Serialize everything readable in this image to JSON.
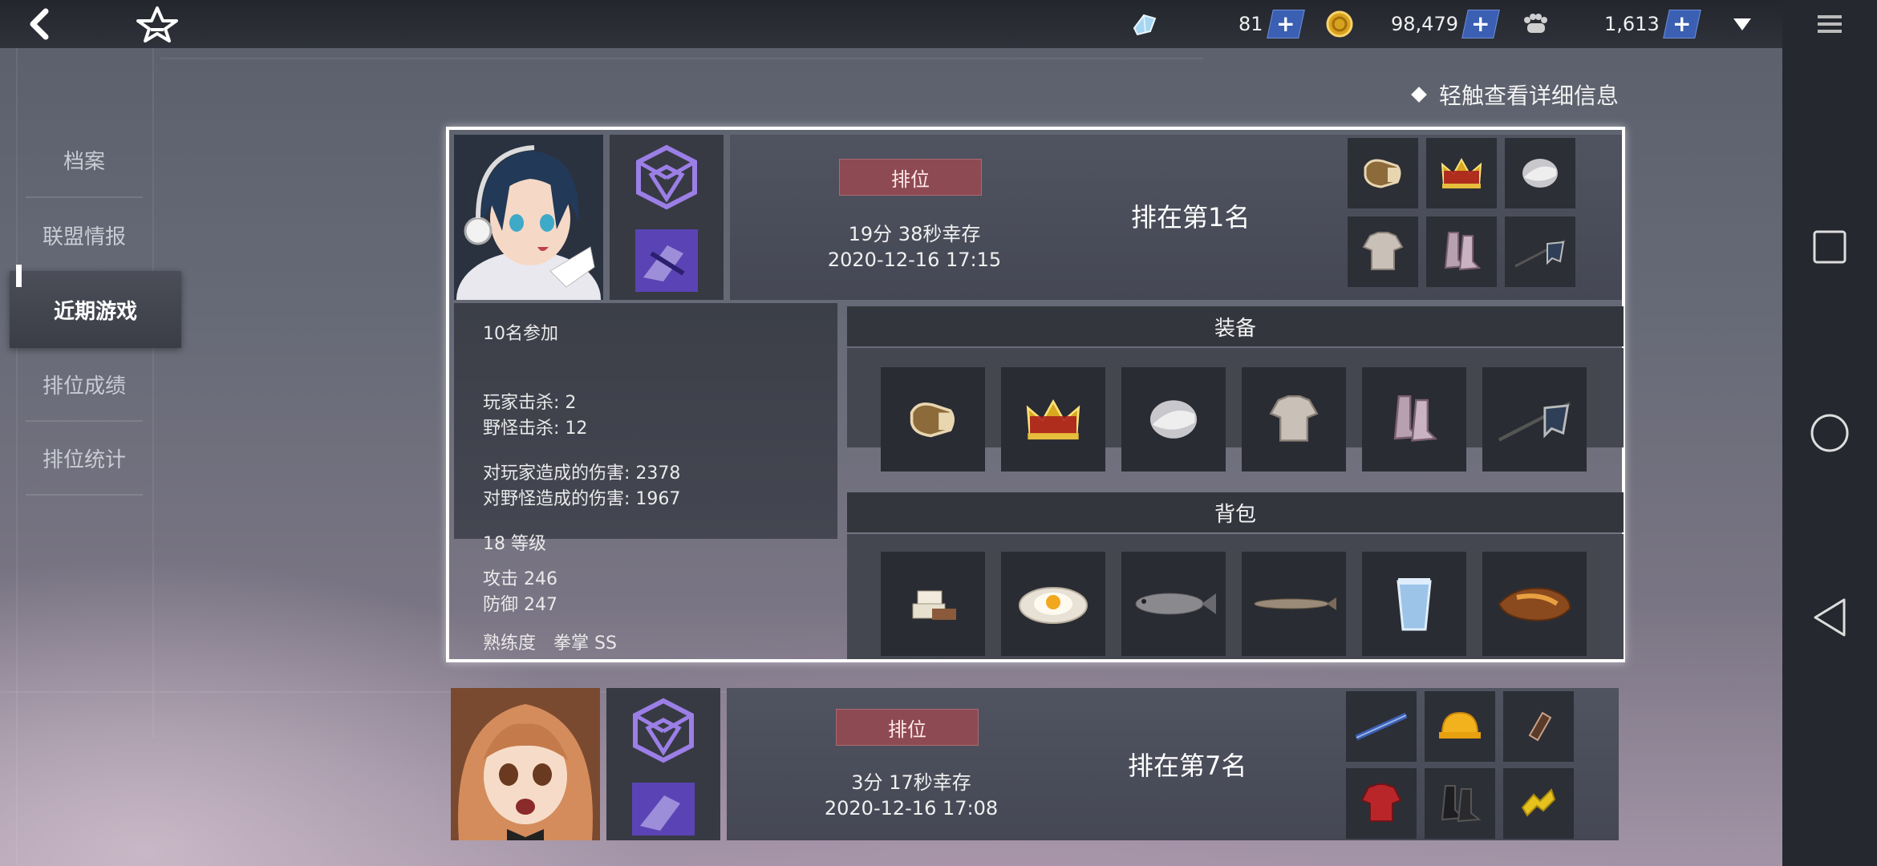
{
  "topbar": {
    "back_icon": "back-arrow-icon",
    "logo_icon": "star-a-logo-icon",
    "resources": [
      {
        "icon": "crystal-icon",
        "value": "81"
      },
      {
        "icon": "gold-coin-icon",
        "value": "98,479"
      },
      {
        "icon": "paw-token-icon",
        "value": "1,613"
      }
    ],
    "plus_label": "+",
    "dropdown_icon": "dropdown-triangle-icon",
    "menu_icon": "hamburger-menu-icon"
  },
  "side_menu": {
    "items": [
      {
        "label": "档案"
      },
      {
        "label": "联盟情报"
      },
      {
        "label": "近期游戏",
        "active": true
      },
      {
        "label": "排位成绩"
      },
      {
        "label": "排位统计"
      }
    ]
  },
  "hint": "轻触查看详细信息",
  "games": [
    {
      "mode_label": "排位",
      "survival_time": "19分 38秒幸存",
      "datetime": "2020-12-16 17:15",
      "rank_text": "排在第1名",
      "selected": true,
      "details": {
        "participants": "10名参加",
        "player_kills": "玩家击杀: 2",
        "monster_kills": "野怪击杀: 12",
        "player_damage": "对玩家造成的伤害: 2378",
        "monster_damage": "对野怪造成的伤害: 1967",
        "level": "18 等级",
        "attack": "攻击 246",
        "defense": "防御 247",
        "mastery": "熟练度　拳掌 SS",
        "equipment_title": "装备",
        "backpack_title": "背包",
        "equipment": [
          "gauntlet-icon",
          "crown-icon",
          "disc-icon",
          "armor-icon",
          "boots-icon",
          "flag-spear-icon"
        ],
        "backpack": [
          "stacked-boxes-icon",
          "fried-egg-icon",
          "fish-icon",
          "dried-fish-icon",
          "water-cup-icon",
          "sweet-potato-icon"
        ]
      }
    },
    {
      "mode_label": "排位",
      "survival_time": "3分 17秒幸存",
      "datetime": "2020-12-16 17:08",
      "rank_text": "排在第7名",
      "selected": false,
      "equipment": [
        "rifle-icon",
        "helmet-icon",
        "bracer-icon",
        "red-jacket-icon",
        "black-boots-icon",
        "gold-ornament-icon"
      ]
    }
  ],
  "colors": {
    "accent_blue": "#3a5fb3",
    "rank_badge": "#8e4a52",
    "mode_icon_purple": "#9b7fe6"
  }
}
